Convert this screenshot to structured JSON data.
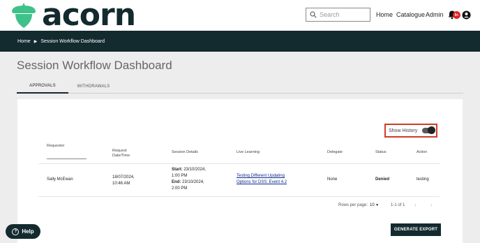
{
  "header": {
    "brand": "acorn",
    "search_placeholder": "Search",
    "nav": [
      "Home",
      "Catalogue",
      "Admin"
    ],
    "notification_count": "9+",
    "icons": {
      "logo": "acorn-logo-icon",
      "search": "search-icon",
      "bell": "bell-icon",
      "user": "user-icon"
    }
  },
  "breadcrumb": {
    "home": "Home",
    "current": "Session Workflow Dashboard"
  },
  "page": {
    "title": "Session Workflow Dashboard"
  },
  "tabs": [
    {
      "label": "APPROVALS",
      "active": true
    },
    {
      "label": "WITHDRAWALS",
      "active": false
    }
  ],
  "history_toggle": {
    "label": "Show History",
    "on": true
  },
  "table": {
    "headers": {
      "requestor": "Requestor",
      "request_date_1": "Request",
      "request_date_2": "Date/Time",
      "session_details": "Session Details",
      "live_learning": "Live Learning",
      "delegate": "Delegate",
      "status": "Status",
      "action": "Action"
    },
    "rows": [
      {
        "requestor": "Sally McEwan",
        "date_line1": "18/07/2024,",
        "date_line2": "10:46 AM",
        "start_label": "Start:",
        "start_line1": " 23/10/2024,",
        "start_line2": "1:00 PM",
        "end_label": "End:",
        "end_line1": " 23/10/2024,",
        "end_line2": "2:00 PM",
        "live_learning_line1": "Testing Different Updating",
        "live_learning_line2": "Options for DSS: Event 4.2",
        "delegate": "None",
        "status": "Denied",
        "action": "testing"
      }
    ]
  },
  "pagination": {
    "rows_label": "Rows per page:",
    "rows_value": "10",
    "range": "1-1 of 1"
  },
  "buttons": {
    "export": "GENERATE EXPORT",
    "help": "Help"
  },
  "colors": {
    "brand_dark": "#132a2e",
    "acorn_green": "#3fc28a",
    "highlight_red": "#d23a2a",
    "badge_red": "#e02424"
  }
}
